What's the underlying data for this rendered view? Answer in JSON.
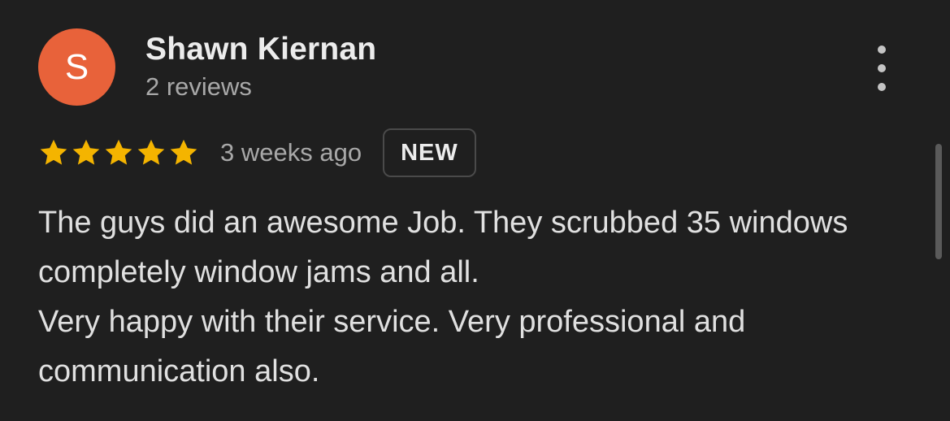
{
  "review": {
    "author": {
      "initial": "S",
      "name": "Shawn Kiernan",
      "review_count": "2 reviews",
      "avatar_color": "#e8623a"
    },
    "rating": {
      "stars": 5,
      "max_stars": 5,
      "star_color": "#f4b400"
    },
    "timestamp": "3 weeks ago",
    "badge": "NEW",
    "text_paragraphs": [
      "The guys did an awesome Job. They scrubbed 35 windows completely window jams and all.",
      "Very happy with their service. Very professional and communication also."
    ],
    "more_menu_icon": "more-vert-icon"
  }
}
